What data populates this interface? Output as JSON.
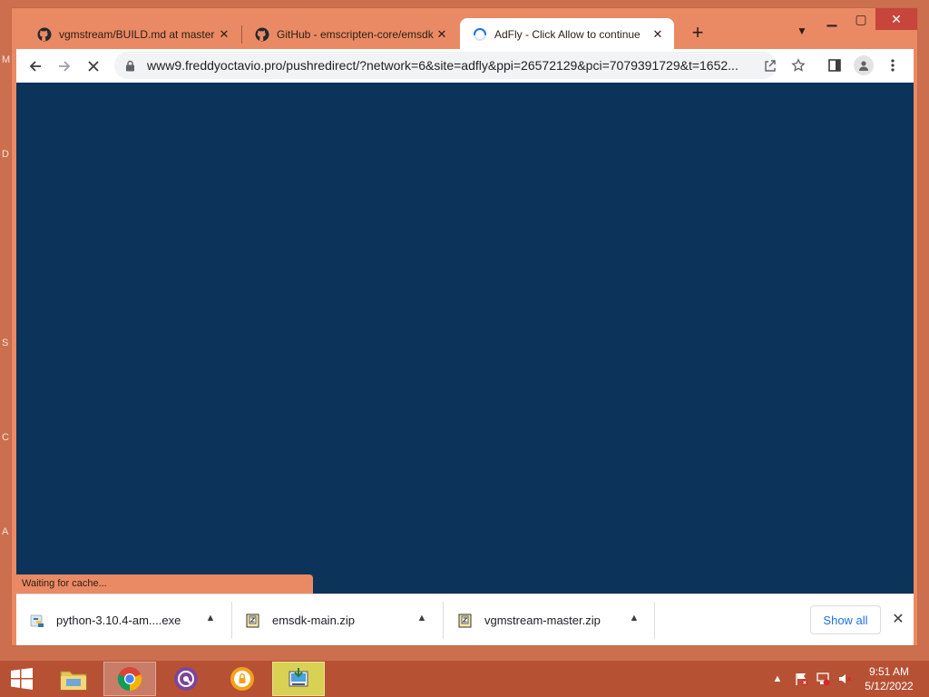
{
  "desktop": {
    "letters": [
      "M",
      "D",
      "S",
      "C",
      "A"
    ]
  },
  "window": {
    "tabs": [
      {
        "title": "vgmstream/BUILD.md at master",
        "icon": "github-icon",
        "active": false
      },
      {
        "title": "GitHub - emscripten-core/emsdk",
        "icon": "github-icon",
        "active": false
      },
      {
        "title": "AdFly - Click Allow to continue",
        "icon": "loading-spinner-icon",
        "active": true
      }
    ],
    "new_tab_label": "+",
    "toolbar": {
      "url": "www9.freddyoctavio.pro/pushredirect/?network=6&site=adfly&ppi=26572129&pci=7079391729&t=1652..."
    },
    "content": {
      "background": "#0c3359"
    },
    "status": "Waiting for cache...",
    "downloads": {
      "items": [
        {
          "name": "python-3.10.4-am....exe",
          "icon": "python-installer-icon"
        },
        {
          "name": "emsdk-main.zip",
          "icon": "zip-file-icon"
        },
        {
          "name": "vgmstream-master.zip",
          "icon": "zip-file-icon"
        }
      ],
      "show_all": "Show all"
    }
  },
  "taskbar": {
    "apps": [
      "file-explorer-icon",
      "chrome-icon",
      "tor-browser-icon",
      "lock-app-icon",
      "installer-icon"
    ],
    "clock": {
      "time": "9:51 AM",
      "date": "5/12/2022"
    }
  },
  "colors": {
    "frame": "#ea8a64",
    "desktop": "#cc6f4e",
    "taskbar": "#b75134",
    "page": "#0c3359",
    "accent": "#1a73e8"
  }
}
